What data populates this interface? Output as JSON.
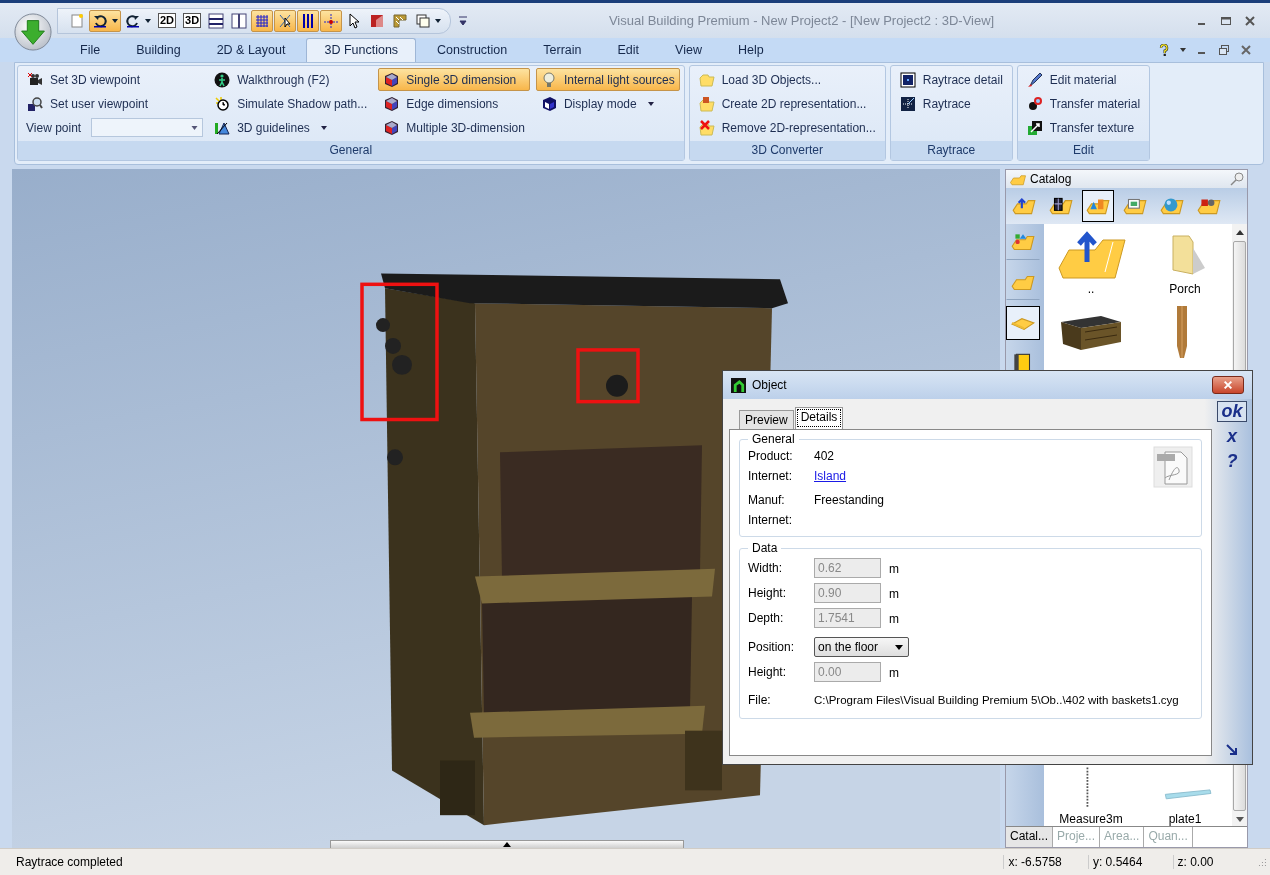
{
  "window": {
    "title": "Visual Building Premium - New Project2 - [New Project2 : 3D-View]"
  },
  "quick_access": [
    {
      "on": false,
      "dropdown": false
    },
    {
      "on": true,
      "dropdown": true
    },
    {
      "on": false,
      "dropdown": true
    },
    {
      "on": false,
      "dropdown": false,
      "text": "2D"
    },
    {
      "on": false,
      "dropdown": false,
      "text": "3D"
    },
    {
      "on": false,
      "dropdown": false
    },
    {
      "on": false,
      "dropdown": false
    },
    {
      "on": true,
      "dropdown": false
    },
    {
      "on": true,
      "dropdown": false
    },
    {
      "on": true,
      "dropdown": false
    },
    {
      "on": true,
      "dropdown": false
    },
    {
      "on": false,
      "dropdown": false
    },
    {
      "on": false,
      "dropdown": false
    },
    {
      "on": false,
      "dropdown": false
    },
    {
      "on": false,
      "dropdown": true
    }
  ],
  "menu_tabs": [
    {
      "label": "File",
      "selected": false
    },
    {
      "label": "Building",
      "selected": false
    },
    {
      "label": "2D & Layout",
      "selected": false
    },
    {
      "label": "3D Functions",
      "selected": true
    },
    {
      "label": "Construction",
      "selected": false
    },
    {
      "label": "Terrain",
      "selected": false
    },
    {
      "label": "Edit",
      "selected": false
    },
    {
      "label": "View",
      "selected": false
    },
    {
      "label": "Help",
      "selected": false
    }
  ],
  "ribbon_groups": [
    {
      "title": "General",
      "columns": [
        [
          {
            "kind": "button",
            "label": "Set 3D viewpoint",
            "on": false,
            "dropdown": false
          },
          {
            "kind": "button",
            "label": "Set user viewpoint",
            "on": false,
            "dropdown": false
          },
          {
            "kind": "combo",
            "label": "View point"
          }
        ],
        [
          {
            "kind": "button",
            "label": "Walkthrough (F2)",
            "on": false,
            "dropdown": false
          },
          {
            "kind": "button",
            "label": "Simulate Shadow path...",
            "on": false,
            "dropdown": false
          },
          {
            "kind": "button",
            "label": "3D guidelines",
            "on": false,
            "dropdown": true
          }
        ],
        [
          {
            "kind": "button",
            "label": "Single 3D dimension",
            "on": true,
            "dropdown": false
          },
          {
            "kind": "button",
            "label": "Edge dimensions",
            "on": false,
            "dropdown": false
          },
          {
            "kind": "button",
            "label": "Multiple 3D-dimension",
            "on": false,
            "dropdown": false
          }
        ],
        [
          {
            "kind": "button",
            "label": "Internal light sources",
            "on": true,
            "dropdown": false
          },
          {
            "kind": "button",
            "label": "Display mode",
            "on": false,
            "dropdown": true
          }
        ]
      ]
    },
    {
      "title": "3D Converter",
      "columns": [
        [
          {
            "kind": "button",
            "label": "Load 3D Objects...",
            "on": false,
            "dropdown": false
          },
          {
            "kind": "button",
            "label": "Create 2D representation...",
            "on": false,
            "dropdown": false
          },
          {
            "kind": "button",
            "label": "Remove 2D-representation...",
            "on": false,
            "dropdown": false
          }
        ]
      ]
    },
    {
      "title": "Raytrace",
      "columns": [
        [
          {
            "kind": "button",
            "label": "Raytrace detail",
            "on": false,
            "dropdown": false
          },
          {
            "kind": "button",
            "label": "Raytrace",
            "on": false,
            "dropdown": false
          }
        ]
      ]
    },
    {
      "title": "Edit",
      "columns": [
        [
          {
            "kind": "button",
            "label": "Edit material",
            "on": false,
            "dropdown": false
          },
          {
            "kind": "button",
            "label": "Transfer material",
            "on": false,
            "dropdown": false
          },
          {
            "kind": "button",
            "label": "Transfer texture",
            "on": false,
            "dropdown": false
          }
        ]
      ]
    }
  ],
  "catalog": {
    "title": "Catalog",
    "categories": [
      {
        "selected": false
      },
      {
        "selected": false
      },
      {
        "selected": true
      },
      {
        "selected": false
      },
      {
        "selected": false
      },
      {
        "selected": false
      }
    ],
    "subcategories": [
      {
        "selected": false
      },
      {
        "selected": false
      },
      {
        "selected": true
      },
      {
        "selected": false
      }
    ],
    "items": [
      {
        "kind": "folder-up",
        "label": ".."
      },
      {
        "kind": "folder",
        "label": "Porch"
      },
      {
        "kind": "dresser"
      },
      {
        "kind": "post"
      },
      {
        "kind": "measure",
        "label": "Measure3m"
      },
      {
        "kind": "plate",
        "label": "plate1"
      }
    ],
    "tabs": [
      {
        "label": "Catal...",
        "selected": true
      },
      {
        "label": "Proje...",
        "selected": false
      },
      {
        "label": "Area...",
        "selected": false
      },
      {
        "label": "Quan...",
        "selected": false
      }
    ]
  },
  "dialog": {
    "title": "Object",
    "tabs": [
      {
        "label": "Preview",
        "selected": false
      },
      {
        "label": "Details",
        "selected": true
      }
    ],
    "general": {
      "title": "General",
      "rows": [
        {
          "kind": "text",
          "label": "Product:",
          "value": "402"
        },
        {
          "kind": "link",
          "label": "Internet:",
          "value": "Island"
        },
        {
          "kind": "text",
          "label": "Manuf:",
          "value": "Freestanding"
        },
        {
          "kind": "text",
          "label": "Internet:"
        }
      ]
    },
    "data": {
      "title": "Data",
      "rows": [
        {
          "kind": "input",
          "label": "Width:",
          "value": "0.62",
          "unit": "m",
          "disabled": true
        },
        {
          "kind": "input",
          "label": "Height:",
          "value": "0.90",
          "unit": "m",
          "disabled": true
        },
        {
          "kind": "input",
          "label": "Depth:",
          "value": "1.7541",
          "unit": "m",
          "disabled": true
        },
        {
          "kind": "select",
          "label": "Position:",
          "value": "on the floor"
        },
        {
          "kind": "input",
          "label": "Height:",
          "value": "0.00",
          "unit": "m",
          "disabled": true
        },
        {
          "kind": "text",
          "label": "File:",
          "value": "C:\\Program Files\\Visual Building Premium 5\\Ob..\\402 with baskets1.cyg"
        }
      ]
    },
    "side_buttons": [
      {
        "label": "ok",
        "default": true
      },
      {
        "label": "x",
        "default": false
      },
      {
        "label": "?",
        "default": false
      }
    ]
  },
  "status_bar": {
    "message": "Raytrace completed",
    "coords": [
      "x: -6.5758",
      "y: 0.5464",
      "z: 0.00"
    ]
  }
}
